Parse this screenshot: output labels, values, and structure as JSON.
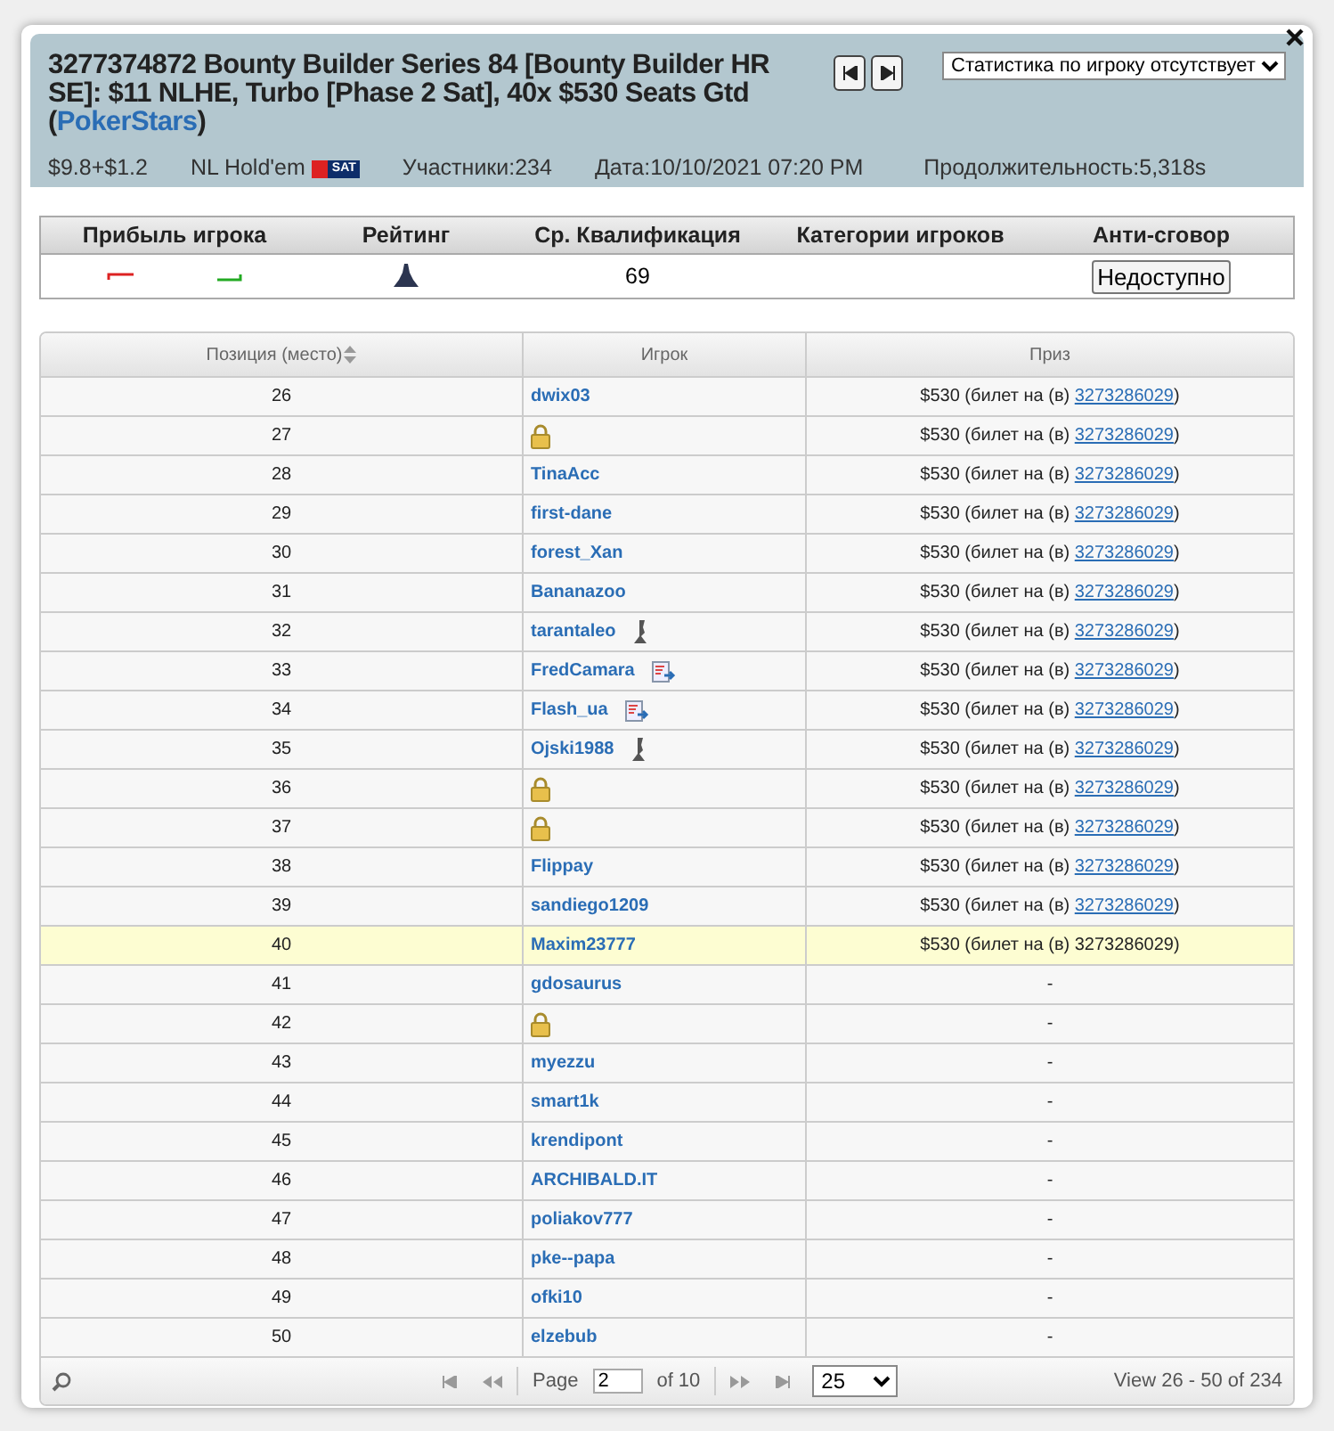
{
  "header": {
    "title": "3277374872 Bounty Builder Series 84 [Bounty Builder HR SE]: $11 NLHE, Turbo [Phase 2 Sat], 40x $530 Seats Gtd (",
    "site": "PokerStars",
    "title_end": ")",
    "stats_select": "Статистика по игроку отсутствует",
    "buyin": "$9.8+$1.2",
    "game": "NL Hold'em",
    "game_badge": "SAT",
    "players": "Участники:234",
    "date": "Дата:10/10/2021 07:20 PM",
    "duration": "Продолжительность:5,318s"
  },
  "summary": {
    "columns": [
      "Прибыль игрока",
      "Рейтинг",
      "Ср. Квалификация",
      "Категории игроков",
      "Анти-сговор"
    ],
    "avg": "69",
    "anti_collusion": "Недоступно"
  },
  "table": {
    "columns": [
      "Позиция (место)",
      "Игрок",
      "Приз"
    ],
    "rows": [
      {
        "place": "26",
        "player": "dwix03",
        "locked": false,
        "selected": false,
        "prize": "$530 (билет на (в) ",
        "ticket": "3273286029",
        "ticket_end": ")",
        "ticket_link": true
      },
      {
        "place": "27",
        "locked": true,
        "selected": false,
        "prize": "$530 (билет на (в) ",
        "ticket": "3273286029",
        "ticket_end": ")",
        "ticket_link": true
      },
      {
        "place": "28",
        "player": "TinaAcc",
        "locked": false,
        "selected": false,
        "prize": "$530 (билет на (в) ",
        "ticket": "3273286029",
        "ticket_end": ")",
        "ticket_link": true
      },
      {
        "place": "29",
        "player": "first-dane",
        "locked": false,
        "selected": false,
        "prize": "$530 (билет на (в) ",
        "ticket": "3273286029",
        "ticket_end": ")",
        "ticket_link": true
      },
      {
        "place": "30",
        "player": "forest_Xan",
        "locked": false,
        "selected": false,
        "prize": "$530 (билет на (в) ",
        "ticket": "3273286029",
        "ticket_end": ")",
        "ticket_link": true
      },
      {
        "place": "31",
        "player": "Bananazoo",
        "locked": false,
        "selected": false,
        "prize": "$530 (билет на (в) ",
        "ticket": "3273286029",
        "ticket_end": ")",
        "ticket_link": true
      },
      {
        "place": "32",
        "player": "tarantaleo",
        "kind": "pawn",
        "locked": false,
        "selected": false,
        "prize": "$530 (билет на (в) ",
        "ticket": "3273286029",
        "ticket_end": ")",
        "ticket_link": true
      },
      {
        "place": "33",
        "player": "FredCamara",
        "kind": "note",
        "locked": false,
        "selected": false,
        "prize": "$530 (билет на (в) ",
        "ticket": "3273286029",
        "ticket_end": ")",
        "ticket_link": true
      },
      {
        "place": "34",
        "player": "Flash_ua",
        "kind": "note",
        "locked": false,
        "selected": false,
        "prize": "$530 (билет на (в) ",
        "ticket": "3273286029",
        "ticket_end": ")",
        "ticket_link": true
      },
      {
        "place": "35",
        "player": "Ojski1988",
        "kind": "pawn",
        "locked": false,
        "selected": false,
        "prize": "$530 (билет на (в) ",
        "ticket": "3273286029",
        "ticket_end": ")",
        "ticket_link": true
      },
      {
        "place": "36",
        "locked": true,
        "selected": false,
        "prize": "$530 (билет на (в) ",
        "ticket": "3273286029",
        "ticket_end": ")",
        "ticket_link": true
      },
      {
        "place": "37",
        "locked": true,
        "selected": false,
        "prize": "$530 (билет на (в) ",
        "ticket": "3273286029",
        "ticket_end": ")",
        "ticket_link": true
      },
      {
        "place": "38",
        "player": "Flippay",
        "locked": false,
        "selected": false,
        "prize": "$530 (билет на (в) ",
        "ticket": "3273286029",
        "ticket_end": ")",
        "ticket_link": true
      },
      {
        "place": "39",
        "player": "sandiego1209",
        "locked": false,
        "selected": false,
        "prize": "$530 (билет на (в) ",
        "ticket": "3273286029",
        "ticket_end": ")",
        "ticket_link": true
      },
      {
        "place": "40",
        "player": "Maxim23777",
        "locked": false,
        "selected": true,
        "prize": "$530 (билет на (в) ",
        "ticket": "3273286029",
        "ticket_end": ")",
        "ticket_link": false
      },
      {
        "place": "41",
        "player": "gdosaurus",
        "locked": false,
        "selected": false,
        "prize": "-"
      },
      {
        "place": "42",
        "locked": true,
        "selected": false,
        "prize": "-"
      },
      {
        "place": "43",
        "player": "myezzu",
        "locked": false,
        "selected": false,
        "prize": "-"
      },
      {
        "place": "44",
        "player": "smart1k",
        "locked": false,
        "selected": false,
        "prize": "-"
      },
      {
        "place": "45",
        "player": "krendipont",
        "locked": false,
        "selected": false,
        "prize": "-"
      },
      {
        "place": "46",
        "player": "ARCHIBALD.IT",
        "locked": false,
        "selected": false,
        "prize": "-"
      },
      {
        "place": "47",
        "player": "poliakov777",
        "locked": false,
        "selected": false,
        "prize": "-"
      },
      {
        "place": "48",
        "player": "pke--papa",
        "locked": false,
        "selected": false,
        "prize": "-"
      },
      {
        "place": "49",
        "player": "ofki10",
        "locked": false,
        "selected": false,
        "prize": "-"
      },
      {
        "place": "50",
        "player": "elzebub",
        "locked": false,
        "selected": false,
        "prize": "-"
      }
    ]
  },
  "pager": {
    "page_label": "Page",
    "page": "2",
    "of": "of 10",
    "page_size": "25",
    "view": "View 26 - 50 of 234"
  }
}
